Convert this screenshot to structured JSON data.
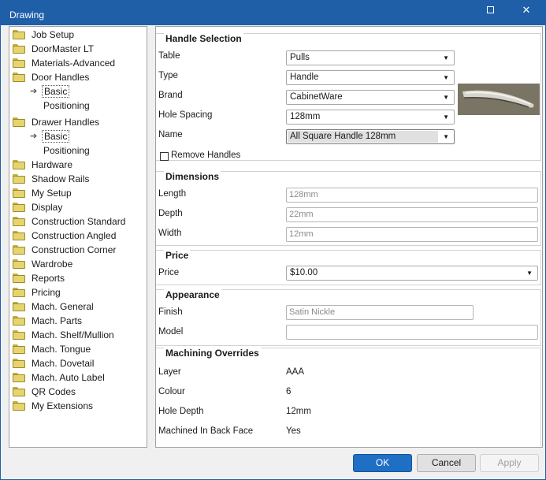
{
  "window": {
    "title": "Drawing",
    "maximize_label": "",
    "close_label": "✕"
  },
  "tree": {
    "items": [
      {
        "label": "Job Setup"
      },
      {
        "label": "DoorMaster LT"
      },
      {
        "label": "Materials-Advanced"
      },
      {
        "label": "Door Handles",
        "children": [
          "Basic",
          "Positioning"
        ]
      },
      {
        "label": "Drawer Handles",
        "children": [
          "Basic",
          "Positioning"
        ]
      },
      {
        "label": "Hardware"
      },
      {
        "label": "Shadow Rails"
      },
      {
        "label": "My Setup"
      },
      {
        "label": "Display"
      },
      {
        "label": "Construction Standard"
      },
      {
        "label": "Construction Angled"
      },
      {
        "label": "Construction Corner"
      },
      {
        "label": "Wardrobe"
      },
      {
        "label": "Reports"
      },
      {
        "label": "Pricing"
      },
      {
        "label": "Mach. General"
      },
      {
        "label": "Mach. Parts"
      },
      {
        "label": "Mach. Shelf/Mullion"
      },
      {
        "label": "Mach. Tongue"
      },
      {
        "label": "Mach. Dovetail"
      },
      {
        "label": "Mach. Auto Label"
      },
      {
        "label": "QR Codes"
      },
      {
        "label": "My Extensions"
      }
    ]
  },
  "handle_selection": {
    "title": "Handle Selection",
    "table_label": "Table",
    "table_value": "Pulls",
    "type_label": "Type",
    "type_value": "Handle",
    "brand_label": "Brand",
    "brand_value": "CabinetWare",
    "hole_spacing_label": "Hole Spacing",
    "hole_spacing_value": "128mm",
    "name_label": "Name",
    "name_value": "All Square Handle 128mm",
    "remove_handles_label": "Remove Handles",
    "remove_handles_checked": false
  },
  "dimensions": {
    "title": "Dimensions",
    "length_label": "Length",
    "length_value": "128mm",
    "depth_label": "Depth",
    "depth_value": "22mm",
    "width_label": "Width",
    "width_value": "12mm"
  },
  "price": {
    "title": "Price",
    "price_label": "Price",
    "price_value": "$10.00"
  },
  "appearance": {
    "title": "Appearance",
    "finish_label": "Finish",
    "finish_value": "Satin Nickle",
    "model_label": "Model",
    "model_value": ""
  },
  "machining": {
    "title": "Machining Overrides",
    "layer_label": "Layer",
    "layer_value": "AAA",
    "colour_label": "Colour",
    "colour_value": "6",
    "hole_depth_label": "Hole Depth",
    "hole_depth_value": "12mm",
    "back_face_label": "Machined In Back Face",
    "back_face_value": "Yes"
  },
  "buttons": {
    "ok": "OK",
    "cancel": "Cancel",
    "apply": "Apply"
  },
  "colors": {
    "titlebar": "#1f5fa8",
    "ok_button": "#1f6fc5",
    "folder": "#e6d56e"
  }
}
